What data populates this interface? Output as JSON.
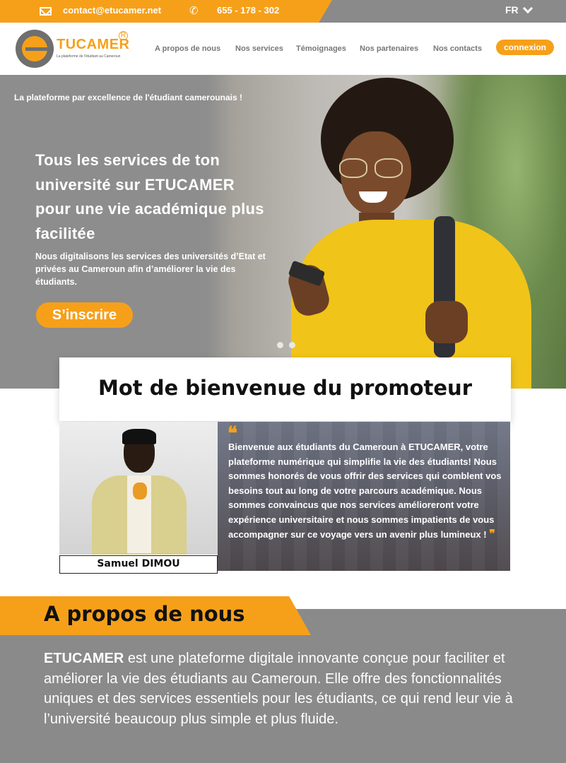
{
  "topbar": {
    "email": "contact@etucamer.net",
    "phone": "655 - 178 - 302",
    "language": "FR",
    "email_icon": "mail-icon",
    "phone_icon": "phone-icon"
  },
  "header": {
    "logo_text": "TUCAMER",
    "logo_tagline": "La plateforme de l'étudiant au Cameroun",
    "logo_registered": "R",
    "nav": [
      "A propos de nous",
      "Nos services",
      "Témoignages",
      "Nos partenaires",
      "Nos contacts"
    ],
    "login_label": "connexion"
  },
  "hero": {
    "tagline": "La plateforme par excellence de l'étudiant camerounais !",
    "title": "Tous les services de ton université sur ETUCAMER pour une vie académique plus facilitée",
    "description": "Nous digitalisons les services des universités d’Etat et privées au Cameroun afin d’améliorer la vie des étudiants.",
    "cta_label": "S’inscrire",
    "carousel_count": 2
  },
  "welcome": {
    "title": "Mot de bienvenue du promoteur",
    "promoter_name": "Samuel DIMOU",
    "quote_open": "❝",
    "quote": "Bienvenue aux étudiants du Cameroun à ETUCAMER, votre plateforme numérique qui simplifie la vie des étudiants! Nous sommes honorés de vous offrir des services qui comblent vos besoins tout au long de votre parcours académique. Nous sommes convaincus que nos services amélioreront votre expérience universitaire et nous sommes impatients de vous accompagner sur ce voyage vers un avenir plus lumineux !",
    "quote_close": "❞"
  },
  "about": {
    "title": "A propos de nous",
    "brand": "ETUCAMER",
    "text": " est une plateforme digitale innovante conçue pour faciliter et améliorer la vie des étudiants au Cameroun. Elle offre des fonctionnalités uniques et des services essentiels pour les étudiants, ce qui rend leur vie à l’université beaucoup plus simple et plus fluide."
  },
  "colors": {
    "accent": "#f6a01a",
    "gray": "#8a8a8a"
  }
}
